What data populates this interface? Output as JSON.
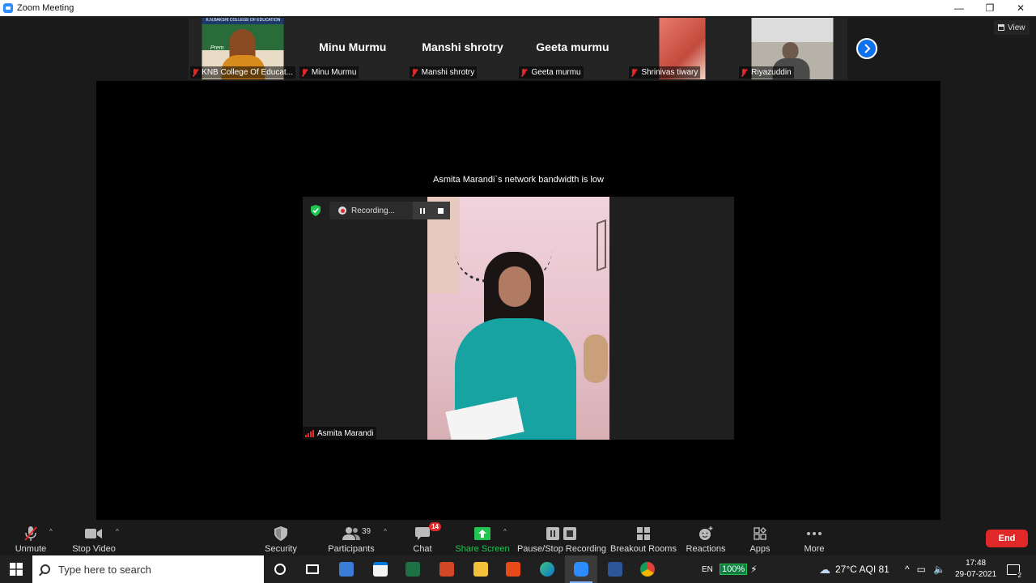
{
  "window": {
    "title": "Zoom Meeting",
    "controls": [
      "—",
      "❐",
      "✕"
    ]
  },
  "gallery": {
    "tiles": [
      {
        "name": "KNB College Of Educat...",
        "has_video": true,
        "banner": "K.N.BAKSHI COLLEGE OF EDUCATION",
        "caption": "Prem"
      },
      {
        "name": "Minu Murmu",
        "big_name": "Minu Murmu",
        "has_video": false
      },
      {
        "name": "Manshi shrotry",
        "big_name": "Manshi shrotry",
        "has_video": false
      },
      {
        "name": "Geeta murmu",
        "big_name": "Geeta murmu",
        "has_video": false
      },
      {
        "name": "Shrinivas tiwary",
        "has_video": true
      },
      {
        "name": "Riyazuddin",
        "has_video": true
      }
    ],
    "view_label": "View"
  },
  "stage": {
    "bandwidth_notice": "Asmita Marandi`s network bandwidth is low",
    "recording_label": "Recording...",
    "speaker_name": "Asmita Marandi"
  },
  "toolbar": {
    "unmute": "Unmute",
    "stop_video": "Stop Video",
    "security": "Security",
    "participants": "Participants",
    "participants_count": "39",
    "chat": "Chat",
    "chat_badge": "14",
    "share_screen": "Share Screen",
    "pause_stop_recording": "Pause/Stop Recording",
    "breakout_rooms": "Breakout Rooms",
    "reactions": "Reactions",
    "apps": "Apps",
    "more": "More",
    "end": "End",
    "caret": "^"
  },
  "taskbar": {
    "search_placeholder": "Type here to search",
    "lang": "EN",
    "battery": "100%",
    "weather": "27°C  AQI 81",
    "time": "17:48",
    "date": "29-07-2021",
    "notification_count": "2"
  },
  "colors": {
    "zoom_blue": "#0e71eb",
    "end_red": "#e02828",
    "share_green": "#23c552",
    "muted_red": "#e02828"
  }
}
